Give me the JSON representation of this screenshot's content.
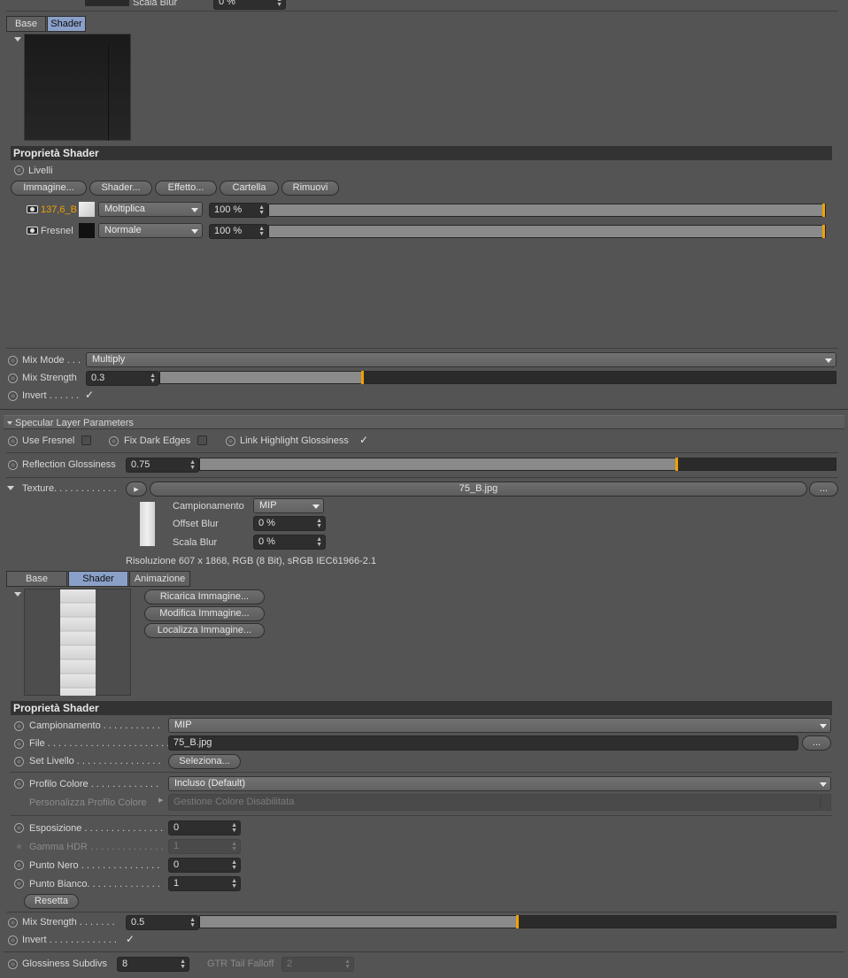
{
  "top": {
    "scala_blur_label": "Scala Blur",
    "scala_blur_value": "0 %"
  },
  "layer_shader": {
    "tabs": [
      "Base",
      "Shader"
    ],
    "section_title": "Proprietà Shader",
    "livelli_label": "Livelli",
    "buttons": [
      "Immagine...",
      "Shader...",
      "Effetto...",
      "Cartella",
      "Rimuovi"
    ],
    "layers": [
      {
        "name": "137,6_B",
        "mode": "Moltiplica",
        "opacity": "100 %",
        "opacity_fraction": 1.0
      },
      {
        "name": "Fresnel",
        "mode": "Normale",
        "opacity": "100 %",
        "opacity_fraction": 1.0
      }
    ]
  },
  "mix1": {
    "mode_label": "Mix Mode . . .",
    "mode_value": "Multiply",
    "strength_label": "Mix Strength",
    "strength_value": "0.3",
    "strength_fraction": 0.3,
    "invert_label": "Invert . . . . . ."
  },
  "specular": {
    "header": "Specular Layer Parameters",
    "use_fresnel": "Use Fresnel",
    "fix_dark_edges": "Fix Dark Edges",
    "link_highlight": "Link Highlight Glossiness",
    "reflection_glossiness_label": "Reflection Glossiness",
    "reflection_glossiness_value": "0.75",
    "reflection_glossiness_fraction": 0.75,
    "texture_label": "Texture. . . . . . . . . . . .",
    "texture_file": "75_B.jpg",
    "more_button": "...",
    "campionamento_label": "Campionamento",
    "campionamento_value": "MIP",
    "offset_blur_label": "Offset Blur",
    "offset_blur_value": "0 %",
    "scala_blur_label": "Scala Blur",
    "scala_blur_value": "0 %",
    "resolution_text": "Risoluzione 607 x 1868, RGB (8 Bit), sRGB IEC61966-2.1"
  },
  "bitmap": {
    "tabs": [
      "Base",
      "Shader",
      "Animazione"
    ],
    "buttons": [
      "Ricarica Immagine...",
      "Modifica Immagine...",
      "Localizza Immagine..."
    ],
    "section_title": "Proprietà Shader",
    "campionamento_label": "Campionamento . . . . . . . . . . .",
    "campionamento_value": "MIP",
    "file_label": "File . . . . . . . . . . . . . . . . . . . . . . .",
    "file_value": "75_B.jpg",
    "file_more": "...",
    "set_livello_label": "Set Livello . . . . . . . . . . . . . . . .",
    "set_livello_button": "Seleziona...",
    "profilo_label": "Profilo Colore . . . . . . . . . . . . .",
    "profilo_value": "Incluso (Default)",
    "personalizza_label": "Personalizza Profilo Colore",
    "personalizza_value": "Gestione Colore Disabilitata",
    "esposizione_label": "Esposizione . . . . . . . . . . . . . . .",
    "esposizione_value": "0",
    "gamma_label": "Gamma HDR . . . . . . . . . . . . . .",
    "gamma_value": "1",
    "punto_nero_label": "Punto Nero . . . . . . . . . . . . . . .",
    "punto_nero_value": "0",
    "punto_bianco_label": "Punto Bianco. . . . . . . . . . . . . .",
    "punto_bianco_value": "1",
    "resetta": "Resetta"
  },
  "mix2": {
    "strength_label": "Mix Strength . . . . . . .",
    "strength_value": "0.5",
    "strength_fraction": 0.5,
    "invert_label": "Invert . . . . . . . . . . . . ."
  },
  "bottom": {
    "subdivs_label": "Glossiness Subdivs",
    "subdivs_value": "8",
    "gtr_label": "GTR Tail Falloff",
    "gtr_value": "2"
  },
  "colors": {
    "accent": "#f0a000",
    "tab_active": "#8aa0c8",
    "layer_name_highlight": "#f0a000"
  }
}
